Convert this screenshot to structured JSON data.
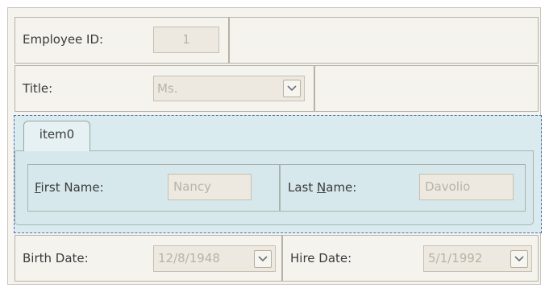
{
  "fields": {
    "employee_id": {
      "label": "Employee ID:",
      "value": "1"
    },
    "title": {
      "label": "Title:",
      "value": "Ms."
    },
    "birth_date": {
      "label": "Birth Date:",
      "value": "12/8/1948"
    },
    "hire_date": {
      "label": "Hire Date:",
      "value": "5/1/1992"
    }
  },
  "tab_group": {
    "tab_label": "item0",
    "first_name": {
      "label_access": "F",
      "label_rest": "irst Name:",
      "value": "Nancy"
    },
    "last_name": {
      "label_pre": "Last ",
      "label_access": "N",
      "label_rest": "ame:",
      "value": "Davolio"
    }
  },
  "icons": {
    "dropdown": "chevron-down-icon"
  },
  "colors": {
    "group_bg": "#d9ebef",
    "focus_border": "#4a6fb5",
    "disabled_text": "#b9b2a5"
  }
}
